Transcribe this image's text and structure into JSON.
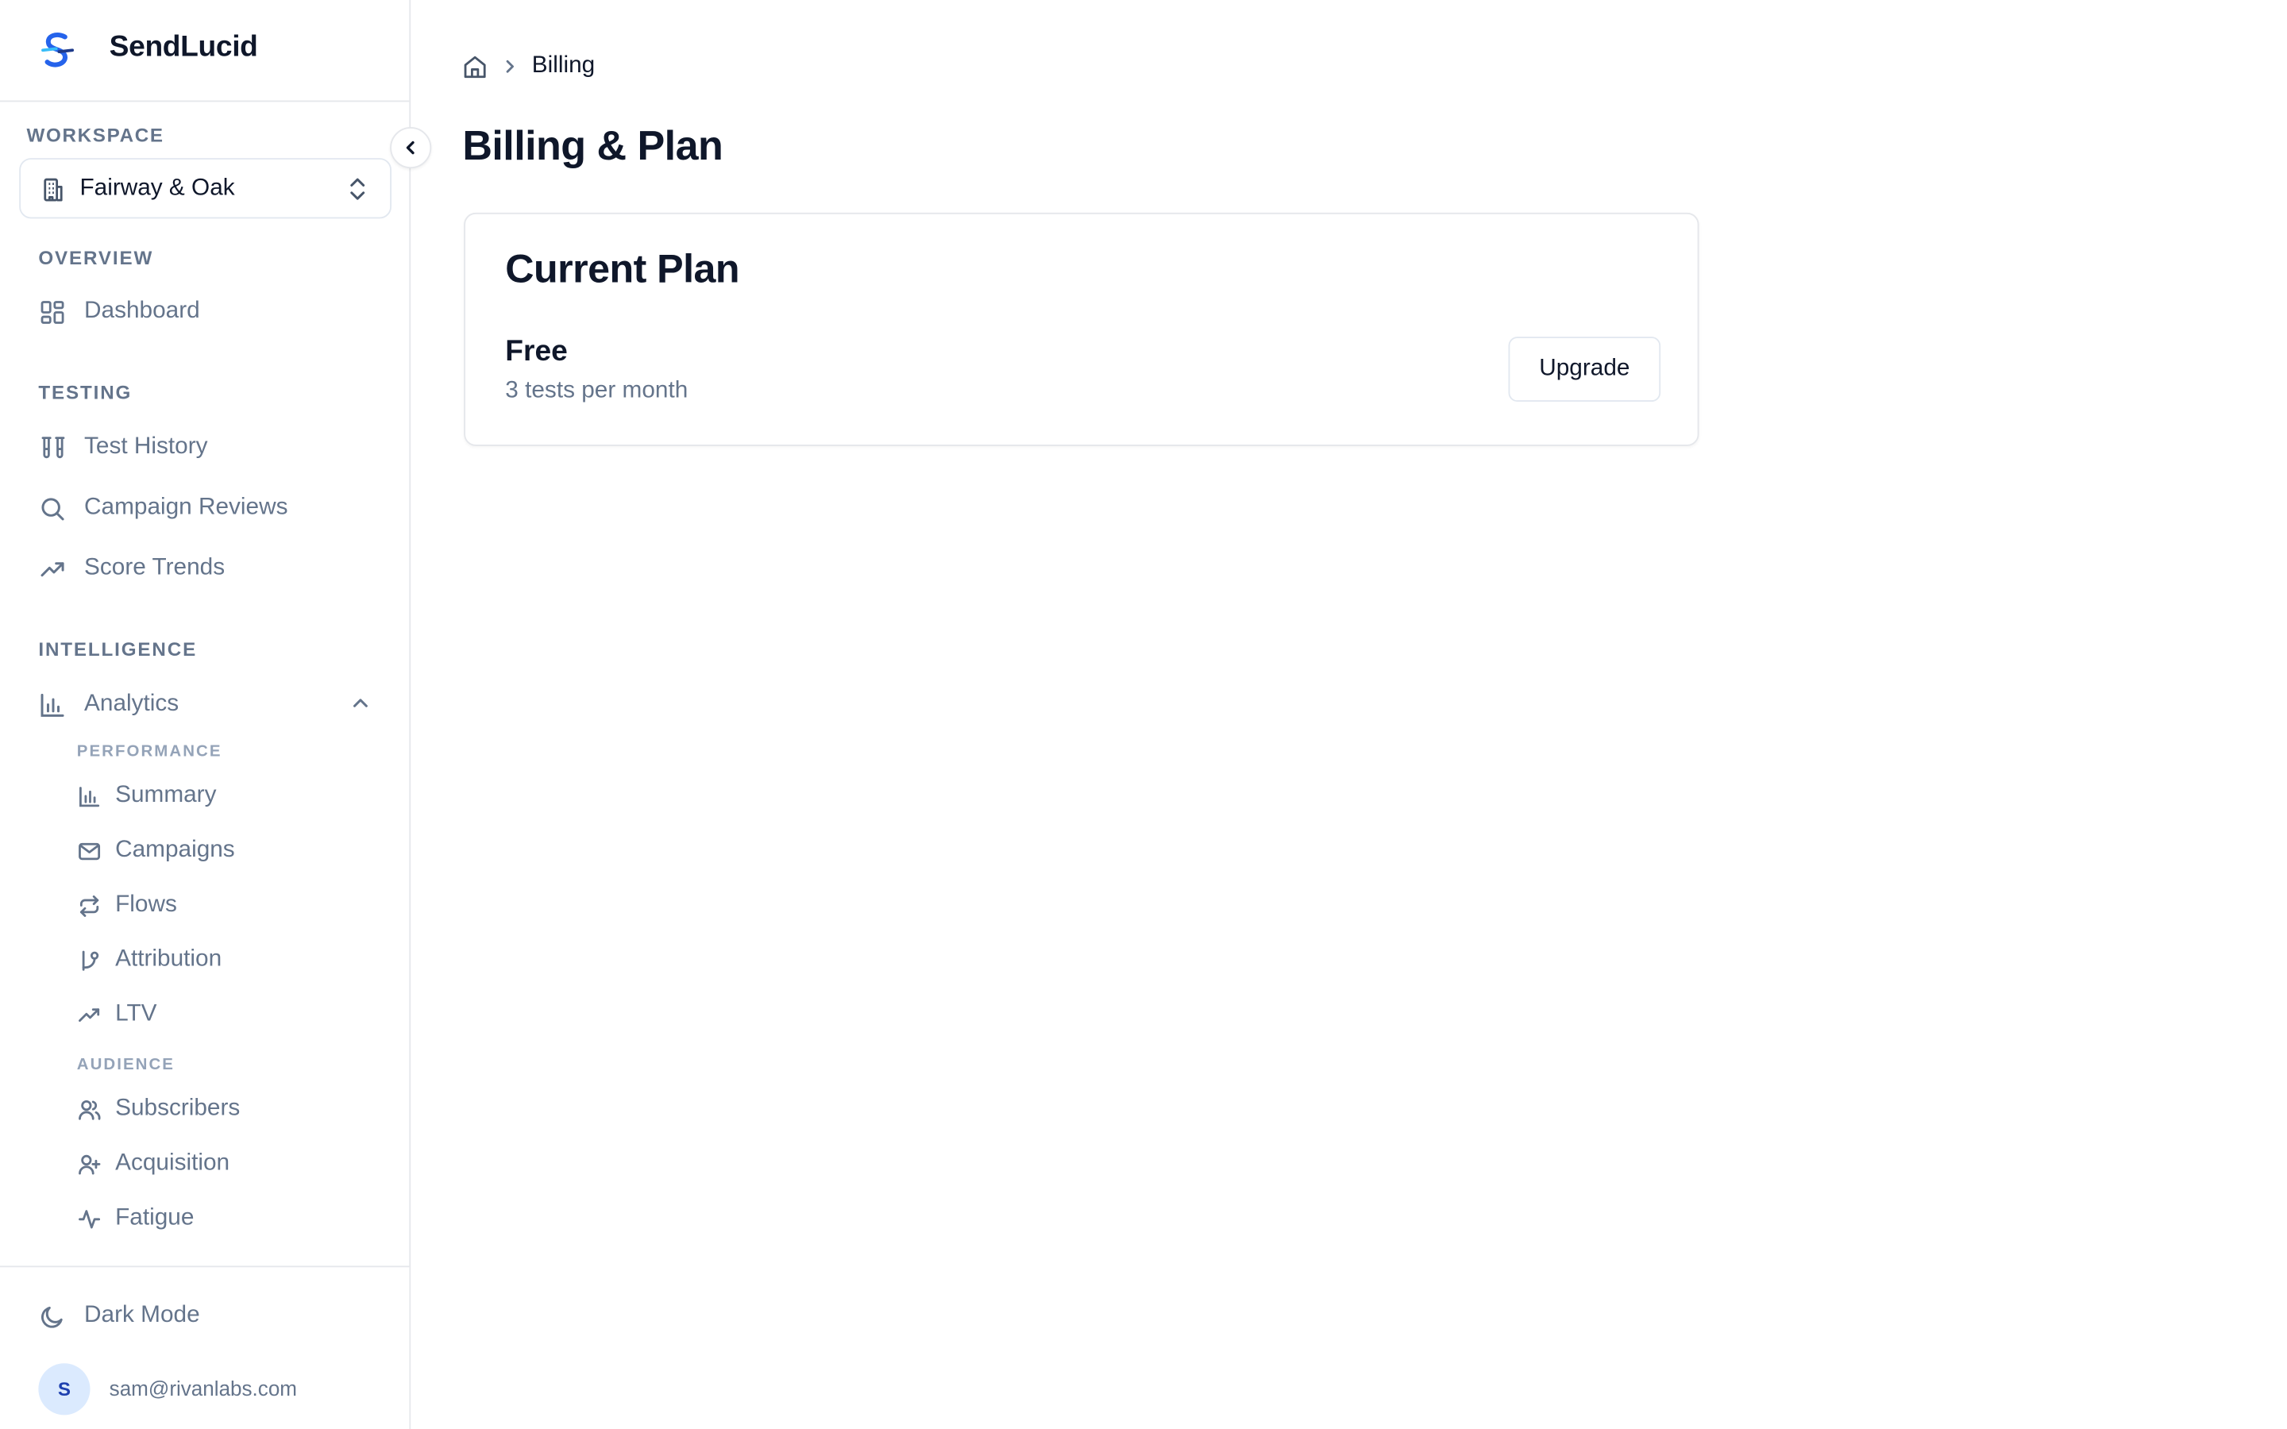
{
  "app": {
    "name": "SendLucid",
    "brand_color": "#2563eb"
  },
  "sidebar": {
    "workspace_label": "WORKSPACE",
    "workspace_name": "Fairway & Oak",
    "sections": {
      "overview": "OVERVIEW",
      "testing": "TESTING",
      "intelligence": "INTELLIGENCE"
    },
    "items": {
      "dashboard": "Dashboard",
      "test_history": "Test History",
      "campaign_reviews": "Campaign Reviews",
      "score_trends": "Score Trends",
      "analytics": "Analytics"
    },
    "analytics": {
      "expanded": true,
      "performance_label": "PERFORMANCE",
      "performance_items": [
        "Summary",
        "Campaigns",
        "Flows",
        "Attribution",
        "LTV"
      ],
      "audience_label": "AUDIENCE",
      "audience_items": [
        "Subscribers",
        "Acquisition",
        "Fatigue"
      ]
    },
    "footer": {
      "dark_mode_label": "Dark Mode",
      "avatar_initial": "S",
      "email": "sam@rivanlabs.com"
    }
  },
  "breadcrumb": {
    "current": "Billing"
  },
  "page": {
    "title": "Billing & Plan"
  },
  "plan_card": {
    "title": "Current Plan",
    "plan_name": "Free",
    "plan_description": "3 tests per month",
    "upgrade_label": "Upgrade"
  },
  "icons": {
    "logo": "sendlucid-logo",
    "home": "home-icon",
    "chevron_right": "chevron-right-icon",
    "chevron_left": "chevron-left-icon",
    "building": "building-icon",
    "chevrons_updown": "chevrons-up-down-icon"
  }
}
